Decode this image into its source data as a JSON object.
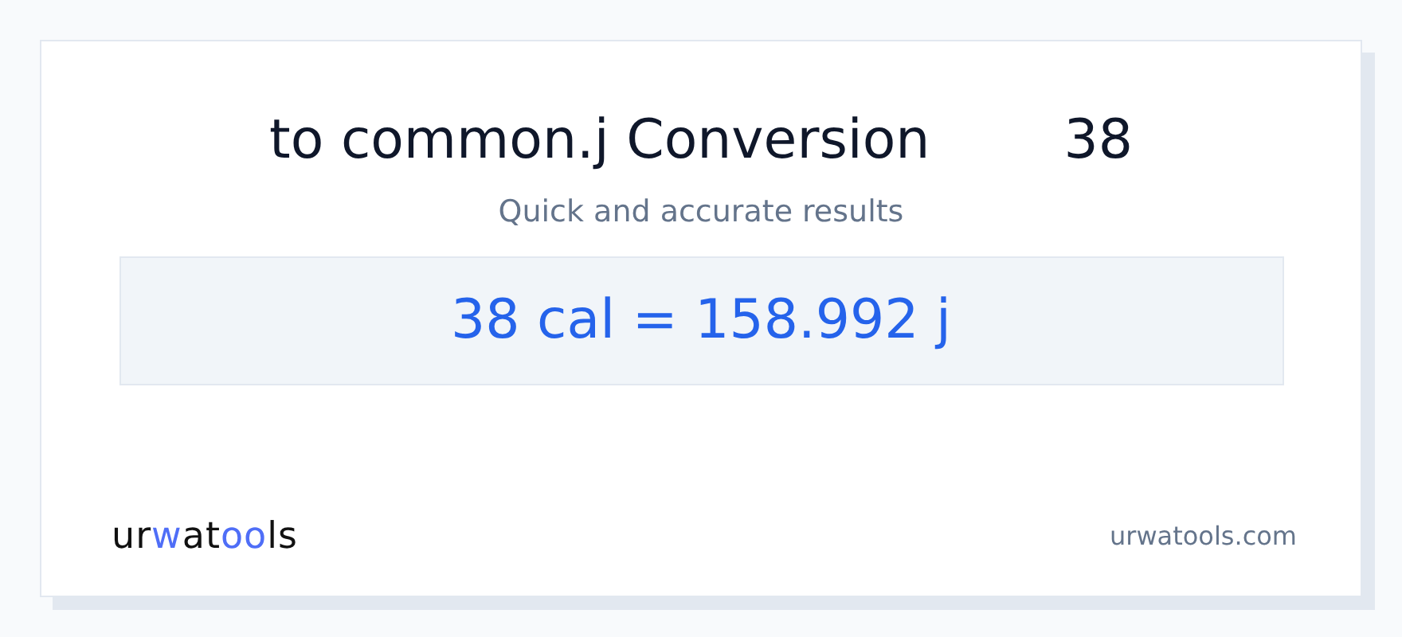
{
  "title": {
    "text": "to common.j Conversion",
    "value": "38"
  },
  "subtitle": "Quick and accurate results",
  "result": "38 cal = 158.992 j",
  "logo": [
    {
      "text": "ur",
      "accent": false
    },
    {
      "text": "w",
      "accent": true
    },
    {
      "text": "at",
      "accent": false
    },
    {
      "text": "oo",
      "accent": true
    },
    {
      "text": "ls",
      "accent": false
    }
  ],
  "site": "urwatools.com"
}
